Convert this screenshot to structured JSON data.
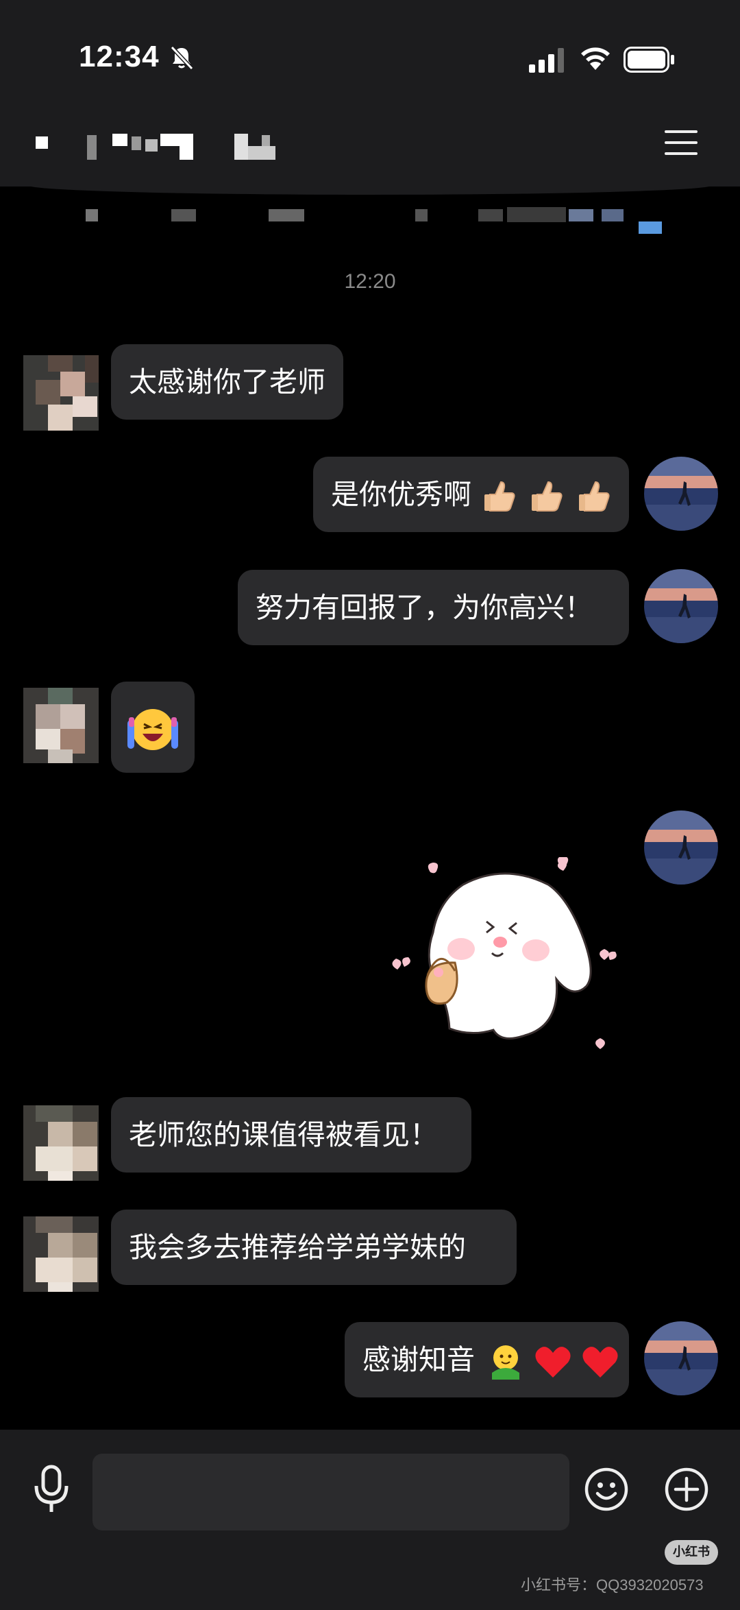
{
  "status_bar": {
    "time": "12:34"
  },
  "chat": {
    "timestamp": "12:20",
    "messages": [
      {
        "side": "left",
        "text": "太感谢你了老师"
      },
      {
        "side": "right",
        "text": "是你优秀啊",
        "emoji": "thumbs-up x3"
      },
      {
        "side": "right",
        "text": "努力有回报了，为你高兴！"
      },
      {
        "side": "left",
        "emoji": "laughing-tears emoji"
      },
      {
        "side": "right",
        "sticker": "bunny-with-basket sticker"
      },
      {
        "side": "left",
        "text": "老师您的课值得被看见！"
      },
      {
        "side": "left",
        "text": "我会多去推荐给学弟学妹的"
      },
      {
        "side": "right",
        "text": "感谢知音",
        "emoji": "hug + hearts"
      }
    ]
  },
  "input": {
    "placeholder": ""
  },
  "watermark": {
    "badge": "小红书",
    "id_text": "小红书号：QQ3932020573"
  },
  "icons": [
    "mute-icon",
    "signal-icon",
    "wifi-icon",
    "battery-icon",
    "menu-icon",
    "microphone-icon",
    "emoji-icon",
    "plus-icon"
  ],
  "colors": {
    "background": "#000000",
    "bar": "#1c1c1e",
    "bubble": "#2b2b2d",
    "text": "#ffffff"
  }
}
